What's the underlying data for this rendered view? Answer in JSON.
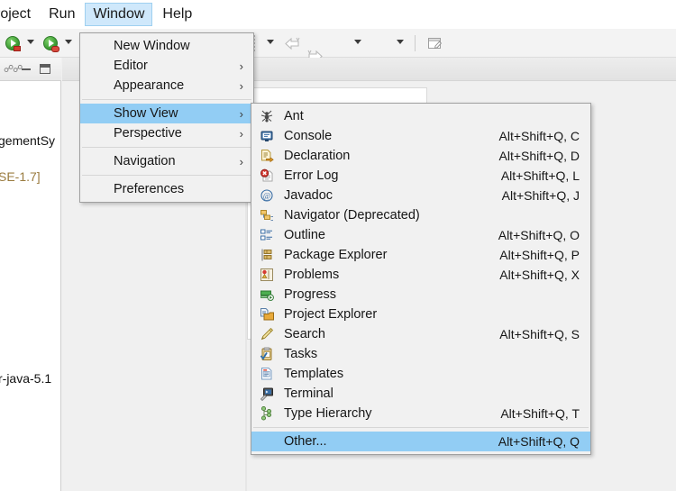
{
  "menubar": {
    "items": [
      {
        "label": "roject",
        "name": "menubar-item-project",
        "active": false,
        "clipped": true
      },
      {
        "label": "Run",
        "name": "menubar-item-run",
        "active": false,
        "clipped": false
      },
      {
        "label": "Window",
        "name": "menubar-item-window",
        "active": true,
        "clipped": false
      },
      {
        "label": "Help",
        "name": "menubar-item-help",
        "active": false,
        "clipped": false
      }
    ]
  },
  "toolbar": {
    "run_icon": "run-icon",
    "debug_icon": "debug-icon",
    "run_dropdown": "run-dropdown-caret",
    "debug_dropdown": "debug-dropdown-caret",
    "back_icon": "back-arrow-icon",
    "forward_icon": "forward-arrow-icon",
    "prev_annotation_icon": "previous-annotation-icon",
    "next_annotation_icon": "next-annotation-icon",
    "new_editor_icon": "new-editor-icon"
  },
  "left_panel": {
    "header_icons": [
      "link-with-editor-icon",
      "minimize-icon",
      "maximize-icon"
    ],
    "rows": [
      {
        "text": "gementSy",
        "amber": false
      },
      {
        "text": "SE-1.7]",
        "amber": true
      },
      {
        "text": "r-java-5.1",
        "amber": false
      }
    ]
  },
  "window_menu": {
    "name": "window-menu",
    "items": [
      {
        "label": "New Window",
        "submenu": false,
        "selected": false,
        "separator_after": false
      },
      {
        "label": "Editor",
        "submenu": true,
        "selected": false,
        "separator_after": false
      },
      {
        "label": "Appearance",
        "submenu": true,
        "selected": false,
        "separator_after": true
      },
      {
        "label": "Show View",
        "submenu": true,
        "selected": true,
        "separator_after": false
      },
      {
        "label": "Perspective",
        "submenu": true,
        "selected": false,
        "separator_after": true
      },
      {
        "label": "Navigation",
        "submenu": true,
        "selected": false,
        "separator_after": true
      },
      {
        "label": "Preferences",
        "submenu": false,
        "selected": false,
        "separator_after": false
      }
    ],
    "submenu_arrow": "›"
  },
  "show_view_menu": {
    "name": "show-view-menu",
    "items": [
      {
        "label": "Ant",
        "accel": "",
        "icon": "ant-icon",
        "selected": false,
        "separator_after": false
      },
      {
        "label": "Console",
        "accel": "Alt+Shift+Q, C",
        "icon": "console-icon",
        "selected": false,
        "separator_after": false
      },
      {
        "label": "Declaration",
        "accel": "Alt+Shift+Q, D",
        "icon": "declaration-icon",
        "selected": false,
        "separator_after": false
      },
      {
        "label": "Error Log",
        "accel": "Alt+Shift+Q, L",
        "icon": "error-log-icon",
        "selected": false,
        "separator_after": false
      },
      {
        "label": "Javadoc",
        "accel": "Alt+Shift+Q, J",
        "icon": "javadoc-icon",
        "selected": false,
        "separator_after": false
      },
      {
        "label": "Navigator (Deprecated)",
        "accel": "",
        "icon": "navigator-icon",
        "selected": false,
        "separator_after": false
      },
      {
        "label": "Outline",
        "accel": "Alt+Shift+Q, O",
        "icon": "outline-icon",
        "selected": false,
        "separator_after": false
      },
      {
        "label": "Package Explorer",
        "accel": "Alt+Shift+Q, P",
        "icon": "package-explorer-icon",
        "selected": false,
        "separator_after": false
      },
      {
        "label": "Problems",
        "accel": "Alt+Shift+Q, X",
        "icon": "problems-icon",
        "selected": false,
        "separator_after": false
      },
      {
        "label": "Progress",
        "accel": "",
        "icon": "progress-icon",
        "selected": false,
        "separator_after": false
      },
      {
        "label": "Project Explorer",
        "accel": "",
        "icon": "project-explorer-icon",
        "selected": false,
        "separator_after": false
      },
      {
        "label": "Search",
        "accel": "Alt+Shift+Q, S",
        "icon": "search-icon",
        "selected": false,
        "separator_after": false
      },
      {
        "label": "Tasks",
        "accel": "",
        "icon": "tasks-icon",
        "selected": false,
        "separator_after": false
      },
      {
        "label": "Templates",
        "accel": "",
        "icon": "templates-icon",
        "selected": false,
        "separator_after": false
      },
      {
        "label": "Terminal",
        "accel": "",
        "icon": "terminal-icon",
        "selected": false,
        "separator_after": false
      },
      {
        "label": "Type Hierarchy",
        "accel": "Alt+Shift+Q, T",
        "icon": "type-hierarchy-icon",
        "selected": false,
        "separator_after": true
      },
      {
        "label": "Other...",
        "accel": "Alt+Shift+Q, Q",
        "icon": "",
        "selected": true,
        "separator_after": false
      }
    ]
  },
  "colors": {
    "menu_bg": "#f1f1f1",
    "menu_border": "#a0a0a0",
    "selection_blue": "#92cdf4",
    "menubar_highlight": "#cfe8fb",
    "amber_text": "#9a7b3f",
    "toolbar_bg": "#f3f3f3",
    "editor_bg": "#f0f0f0"
  }
}
